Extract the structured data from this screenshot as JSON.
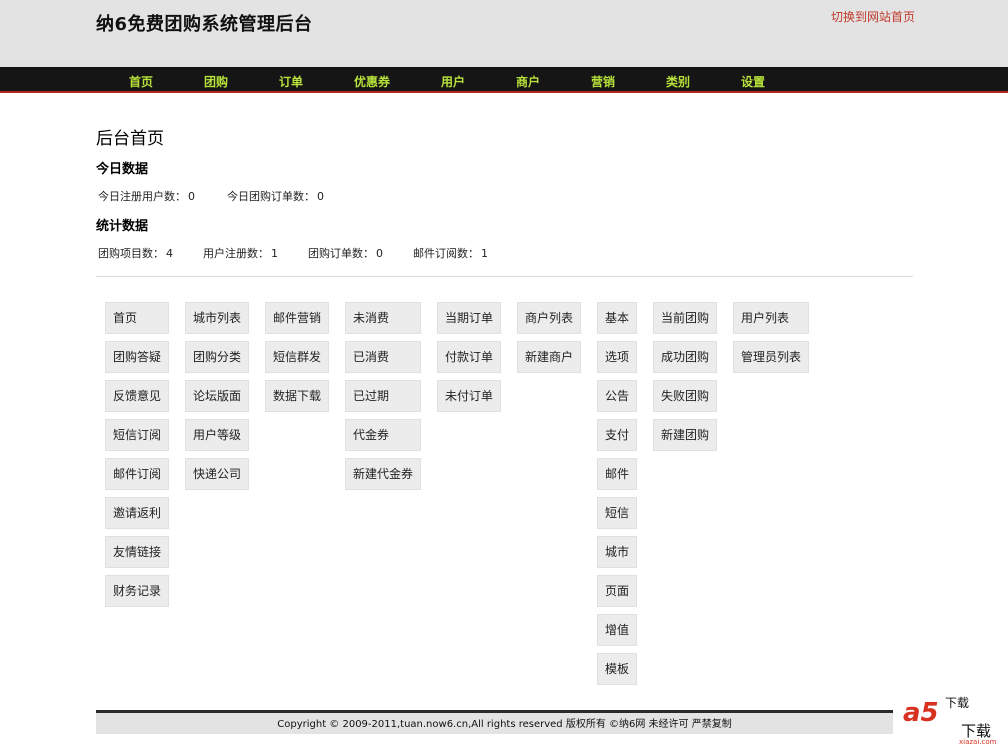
{
  "header": {
    "title": "纳6免费团购系统管理后台",
    "switch_link": "切换到网站首页"
  },
  "nav": [
    "首页",
    "团购",
    "订单",
    "优惠券",
    "用户",
    "商户",
    "营销",
    "类别",
    "设置"
  ],
  "main": {
    "title": "后台首页",
    "today": {
      "heading": "今日数据",
      "stats": [
        {
          "label": "今日注册用户数：",
          "value": "0"
        },
        {
          "label": "今日团购订单数：",
          "value": "0"
        }
      ]
    },
    "summary": {
      "heading": "统计数据",
      "stats": [
        {
          "label": "团购项目数：",
          "value": "4"
        },
        {
          "label": "用户注册数：",
          "value": "1"
        },
        {
          "label": "团购订单数：",
          "value": "0"
        },
        {
          "label": "邮件订阅数：",
          "value": "1"
        }
      ]
    }
  },
  "menu_columns": [
    [
      "首页",
      "团购答疑",
      "反馈意见",
      "短信订阅",
      "邮件订阅",
      "邀请返利",
      "友情链接",
      "财务记录"
    ],
    [
      "城市列表",
      "团购分类",
      "论坛版面",
      "用户等级",
      "快递公司"
    ],
    [
      "邮件营销",
      "短信群发",
      "数据下载"
    ],
    [
      "未消费",
      "已消费",
      "已过期",
      "代金券",
      "新建代金券"
    ],
    [
      "当期订单",
      "付款订单",
      "未付订单"
    ],
    [
      "商户列表",
      "新建商户"
    ],
    [
      "基本",
      "选项",
      "公告",
      "支付",
      "邮件",
      "短信",
      "城市",
      "页面",
      "增值",
      "模板"
    ],
    [
      "当前团购",
      "成功团购",
      "失败团购",
      "新建团购"
    ],
    [
      "用户列表",
      "管理员列表"
    ]
  ],
  "footer": {
    "text": "Copyright © 2009-2011,tuan.now6.cn,All rights reserved 版权所有 ©纳6网 未经许可 严禁复制"
  },
  "watermark": {
    "logo": "a5",
    "text1": "下载",
    "text2": "下载",
    "sub": "xiazai.com"
  },
  "colors": {
    "nav_text": "#b7e23a",
    "nav_bg": "#151515",
    "accent_red": "#b3261e",
    "link": "#c0392b"
  }
}
